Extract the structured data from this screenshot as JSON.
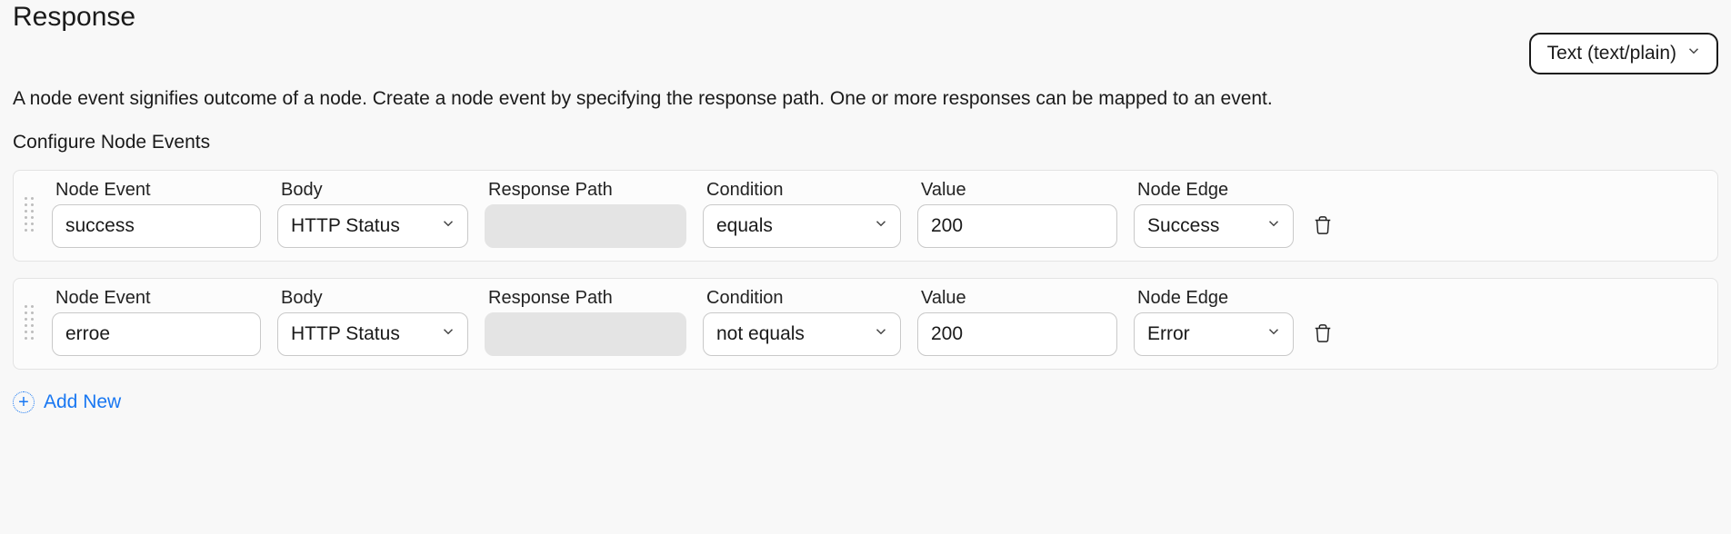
{
  "header": {
    "title": "Response",
    "type_select": "Text (text/plain)"
  },
  "description": "A node event signifies outcome of a node. Create a node event by specifying the response path. One or more responses can be mapped to an event.",
  "subheader": "Configure Node Events",
  "columns": {
    "node_event": "Node Event",
    "body": "Body",
    "response_path": "Response Path",
    "condition": "Condition",
    "value": "Value",
    "node_edge": "Node Edge"
  },
  "rows": [
    {
      "node_event": "success",
      "body": "HTTP Status",
      "response_path": "",
      "condition": "equals",
      "value": "200",
      "node_edge": "Success"
    },
    {
      "node_event": "erroe",
      "body": "HTTP Status",
      "response_path": "",
      "condition": "not equals",
      "value": "200",
      "node_edge": "Error"
    }
  ],
  "add_new_label": "Add New"
}
